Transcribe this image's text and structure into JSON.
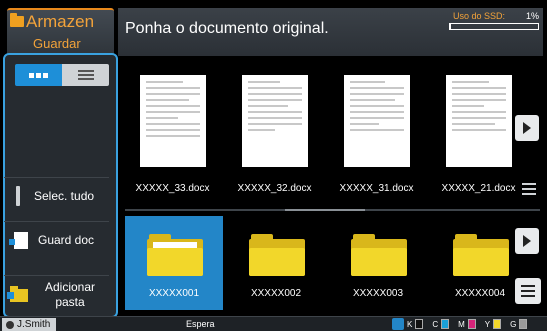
{
  "app": {
    "title": "Armazen",
    "subtitle": "Guardar"
  },
  "header": {
    "message": "Ponha o documento original.",
    "ssd_label": "Uso do SSD:",
    "ssd_percent": "1%",
    "ssd_fill": 0.01
  },
  "sidebar": {
    "view_modes": [
      "thumbnails",
      "list"
    ],
    "active_view": "thumbnails",
    "select_all": "Selec. tudo",
    "save_doc": "Guard doc",
    "add_folder": "Adicionar pasta"
  },
  "files": [
    {
      "name": "XXXXX_33.docx"
    },
    {
      "name": "XXXXX_32.docx"
    },
    {
      "name": "XXXXX_31.docx"
    },
    {
      "name": "XXXXX_21.docx"
    }
  ],
  "folders": [
    {
      "name": "XXXXX001",
      "selected": true
    },
    {
      "name": "XXXXX002",
      "selected": false
    },
    {
      "name": "XXXXX003",
      "selected": false
    },
    {
      "name": "XXXXX004",
      "selected": false
    }
  ],
  "status": {
    "user": "J.Smith",
    "state": "Espera",
    "inks": [
      {
        "label": "K",
        "color": "#111111"
      },
      {
        "label": "C",
        "color": "#1aa0d8"
      },
      {
        "label": "M",
        "color": "#d6247a"
      },
      {
        "label": "Y",
        "color": "#f2d72a"
      },
      {
        "label": "G",
        "color": "#9a9a9a"
      }
    ]
  },
  "colors": {
    "accent": "#f3a33a",
    "selection": "#2386c8",
    "panel_border": "#3aa2e0"
  }
}
